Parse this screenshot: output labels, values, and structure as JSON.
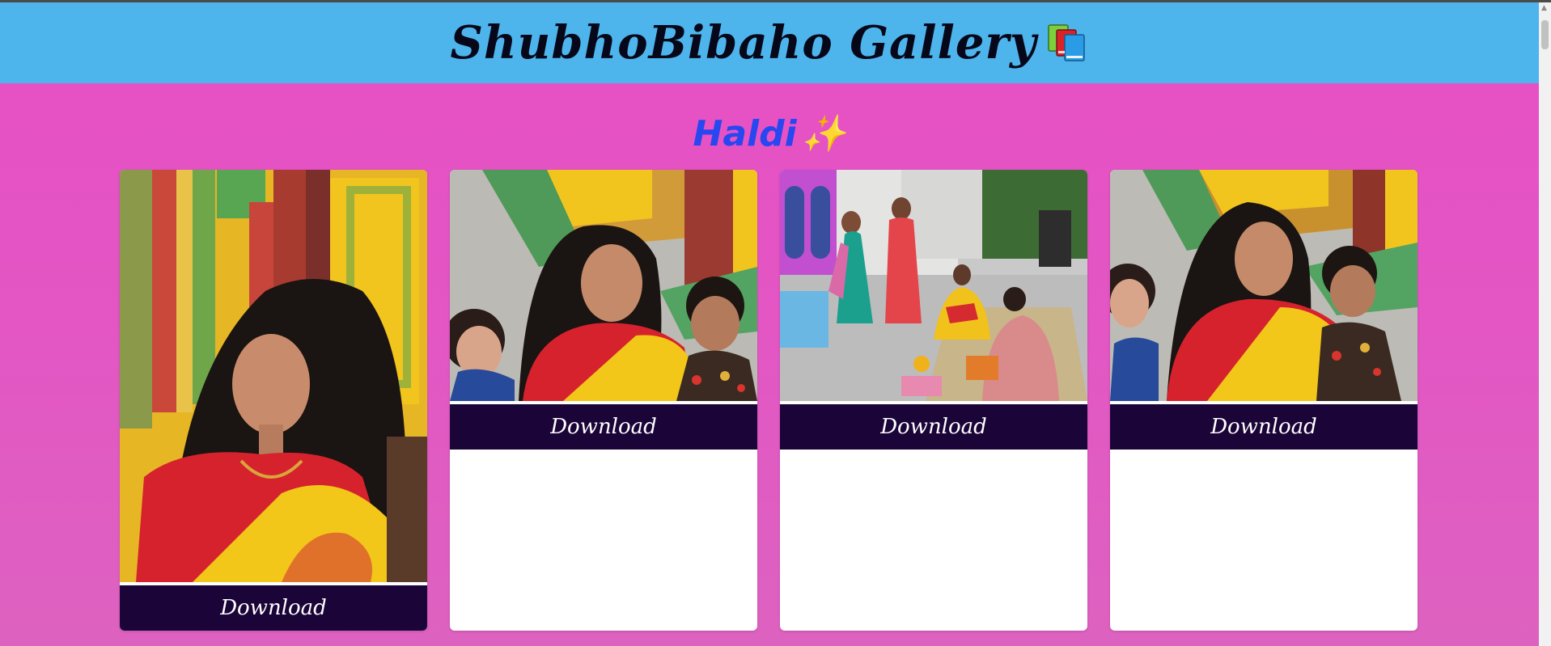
{
  "header": {
    "title": "ShubhoBibaho Gallery",
    "icon": "books-icon"
  },
  "section": {
    "title": "Haldi",
    "icon": "sparkles-icon"
  },
  "cards": [
    {
      "photo": "portrait-woman-yellow-saree",
      "download_label": "Download"
    },
    {
      "photo": "woman-with-two-children",
      "download_label": "Download"
    },
    {
      "photo": "haldi-ceremony-courtyard",
      "download_label": "Download"
    },
    {
      "photo": "woman-with-children-temple",
      "download_label": "Download"
    }
  ],
  "colors": {
    "header_bg": "#4db5ec",
    "page_bg": "#e74fc4",
    "section_title": "#2747f0",
    "button_bg": "#1b0438",
    "button_text": "#ffffff",
    "card_bg": "#ffffff"
  }
}
